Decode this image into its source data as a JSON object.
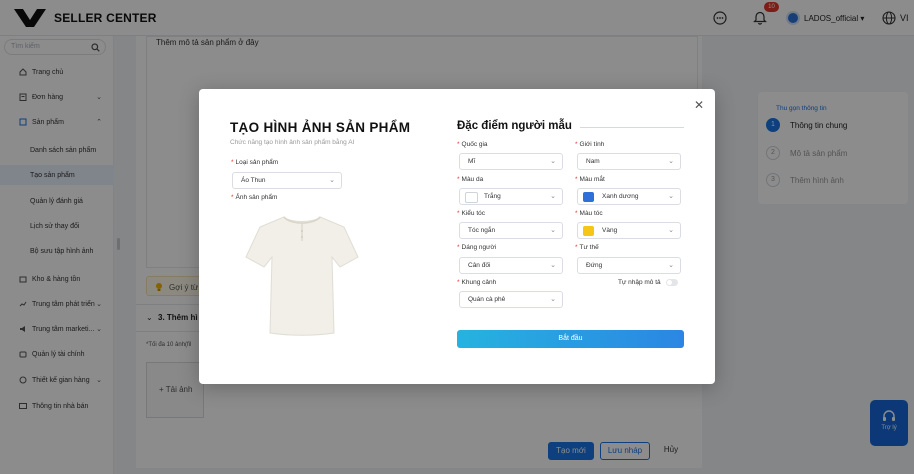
{
  "header": {
    "brand": "SELLER CENTER",
    "notification_count": "10",
    "username": "LADOS_official",
    "language": "VI"
  },
  "sidebar": {
    "search_placeholder": "Tìm kiếm",
    "items": [
      {
        "label": "Trang chủ",
        "icon": "home-icon"
      },
      {
        "label": "Đơn hàng",
        "icon": "order-icon"
      },
      {
        "label": "Sản phẩm",
        "icon": "product-icon"
      },
      {
        "label": "Danh sách sản phẩm"
      },
      {
        "label": "Tạo sản phẩm"
      },
      {
        "label": "Quản lý đánh giá"
      },
      {
        "label": "Lịch sử thay đổi"
      },
      {
        "label": "Bộ sưu tập hình ảnh"
      },
      {
        "label": "Kho & hàng tồn",
        "icon": "warehouse-icon"
      },
      {
        "label": "Trung tâm phát triển",
        "icon": "chart-icon"
      },
      {
        "label": "Trung tâm marketi...",
        "icon": "megaphone-icon"
      },
      {
        "label": "Quản lý tài chính",
        "icon": "wallet-icon"
      },
      {
        "label": "Thiết kế gian hàng",
        "icon": "palette-icon"
      },
      {
        "label": "Thông tin nhà bán",
        "icon": "id-card-icon"
      }
    ]
  },
  "main": {
    "description_placeholder": "Thêm mô tả sản phẩm ở đây",
    "tip_label": "Gợi ý từ",
    "section3_title": "3. Thêm hì",
    "max_images_note": "*Tối đa 10 ảnh(fil",
    "upload_label": "+ Tải ảnh",
    "create_button": "Tạo mới",
    "draft_button": "Lưu nháp",
    "cancel_button": "Hủy"
  },
  "steps": {
    "collapse_label": "Thu gọn thông tin",
    "items": [
      {
        "number": "1",
        "label": "Thông tin chung"
      },
      {
        "number": "2",
        "label": "Mô tả sản phẩm"
      },
      {
        "number": "3",
        "label": "Thêm hình ảnh"
      }
    ]
  },
  "support": {
    "label": "Trợ lý"
  },
  "modal": {
    "title": "TẠO HÌNH ẢNH SẢN PHẨM",
    "subtitle": "Chức năng tạo hình ảnh sản phẩm bằng AI",
    "product_type_label": "Loại sản phẩm",
    "product_type_value": "Áo Thun",
    "product_image_label": "Ảnh sản phẩm",
    "model_title": "Đặc điểm người mẫu",
    "fields": {
      "country": {
        "label": "Quốc gia",
        "value": "Mĩ"
      },
      "gender": {
        "label": "Giới tính",
        "value": "Nam"
      },
      "skin": {
        "label": "Màu da",
        "value": "Trắng",
        "swatch": "#ffffff"
      },
      "eye": {
        "label": "Màu mắt",
        "value": "Xanh dương",
        "swatch": "#2f6fd8"
      },
      "hairstyle": {
        "label": "Kiểu tóc",
        "value": "Tóc ngắn"
      },
      "haircolor": {
        "label": "Màu tóc",
        "value": "Vàng",
        "swatch": "#f5c518"
      },
      "body": {
        "label": "Dáng người",
        "value": "Cân đối"
      },
      "pose": {
        "label": "Tư thế",
        "value": "Đứng"
      },
      "background": {
        "label": "Khung cảnh",
        "value": "Quán cà phê"
      }
    },
    "custom_desc_label": "Tự nhập mô tả",
    "start_button": "Bắt đầu"
  },
  "colors": {
    "primary": "#1a73e8",
    "start_gradient_from": "#26b3e0",
    "start_gradient_to": "#2b86e3",
    "badge": "#e5332a"
  }
}
